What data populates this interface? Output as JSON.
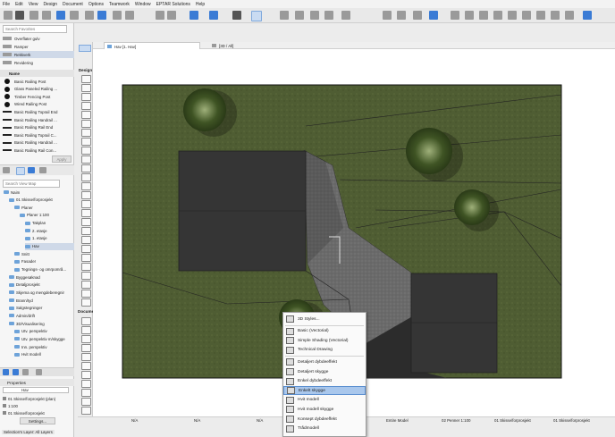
{
  "menu": [
    "File",
    "Edit",
    "View",
    "Design",
    "Document",
    "Options",
    "Teamwork",
    "Window",
    "EPTAR Solutions",
    "Help"
  ],
  "favorites": {
    "search_placeholder": "Search Favorites",
    "top_items": [
      "Overflater gulv",
      "Ramper",
      "Rekkverk",
      "Revidering"
    ],
    "name_header": "Name",
    "railings": [
      "Basic Railing Post",
      "Glass Paneled Railing ...",
      "Timber Fencing Post",
      "Wired Railing Post",
      "Basic Railing Toprail End",
      "Basic Railing Handrail ...",
      "Basic Railing Rail End",
      "Basic Railing Toprail C...",
      "Basic Railing Handrail ...",
      "Basic Railing Rail Con..."
    ],
    "apply_label": "Apply"
  },
  "navigator": {
    "search_placeholder": "Search View Map",
    "tree": [
      {
        "label": "Naim",
        "level": 0
      },
      {
        "label": "01 Skisse/forprosjekt",
        "level": 1
      },
      {
        "label": "Planer",
        "level": 2
      },
      {
        "label": "Planer 1:100",
        "level": 3
      },
      {
        "label": "Takplan",
        "level": 4
      },
      {
        "label": "2. etasje",
        "level": 4
      },
      {
        "label": "1. etasje",
        "level": 4
      },
      {
        "label": "Hav",
        "level": 4
      },
      {
        "label": "Snitt",
        "level": 2
      },
      {
        "label": "Fasader",
        "level": 2
      },
      {
        "label": "Tegnings- og omrpområ...",
        "level": 2
      },
      {
        "label": "Byggesøknad",
        "level": 1
      },
      {
        "label": "Detaljprosjekt",
        "level": 1
      },
      {
        "label": "Skjema og mengdeberegnir",
        "level": 1
      },
      {
        "label": "Brann/tyd",
        "level": 1
      },
      {
        "label": "Salgstegninger",
        "level": 1
      },
      {
        "label": "Admin/drift",
        "level": 1
      },
      {
        "label": "3D/Visualisering",
        "level": 1
      },
      {
        "label": "Utv. perspektiv",
        "level": 2
      },
      {
        "label": "Utv. perspektiv m/skygge",
        "level": 2
      },
      {
        "label": "Inn. perspektiv",
        "level": 2
      },
      {
        "label": "Hvit modell",
        "level": 2
      }
    ]
  },
  "properties": {
    "title": "Properties",
    "name_value": "Hav",
    "rows": [
      "01 Skisse/forprosjekt (plan)",
      "1:100",
      "01 Skisse/forprosjekt"
    ],
    "settings_label": "Settings..."
  },
  "toolbox": {
    "design_label": "Design",
    "document_label": "Docume",
    "more_label": "More"
  },
  "tabs": [
    {
      "label": "Hav [1. Hav]"
    },
    {
      "label": "[3D / All]"
    }
  ],
  "dropdown": {
    "items": [
      {
        "label": "3D Styles...",
        "group": 0
      },
      {
        "label": "Basic (Vectorial)",
        "group": 1
      },
      {
        "label": "Simple Shading (Vectorial)",
        "group": 1
      },
      {
        "label": "Technical Drawing",
        "group": 1
      },
      {
        "label": "Detaljert dybdeeffekt",
        "group": 2
      },
      {
        "label": "Detaljert skygge",
        "group": 2
      },
      {
        "label": "Enkel dybdeeffekt",
        "group": 2
      },
      {
        "label": "Enkelt skygge",
        "group": 2,
        "highlighted": true
      },
      {
        "label": "Hvit modell",
        "group": 2
      },
      {
        "label": "Hvit modell skygge",
        "group": 2
      },
      {
        "label": "Konsept dybdeeffekt",
        "group": 2
      },
      {
        "label": "Trådmodell",
        "group": 2
      }
    ]
  },
  "statusbar": {
    "left_text": "Selection's Layer: All Layers",
    "fields": [
      "N/A",
      "N/A",
      "N/A"
    ],
    "model_label": "Entire Model",
    "pen_label": "02 Penner 1:100",
    "proj_label_1": "01 Skisse/forprosjekt",
    "proj_label_2": "01 Skisse/forprosjekt"
  },
  "colors": {
    "accent": "#3a7bd5",
    "highlight": "#a9c7ec",
    "grass": "#4d5b31",
    "roof": "#353535",
    "path": "#6b6b6b"
  }
}
